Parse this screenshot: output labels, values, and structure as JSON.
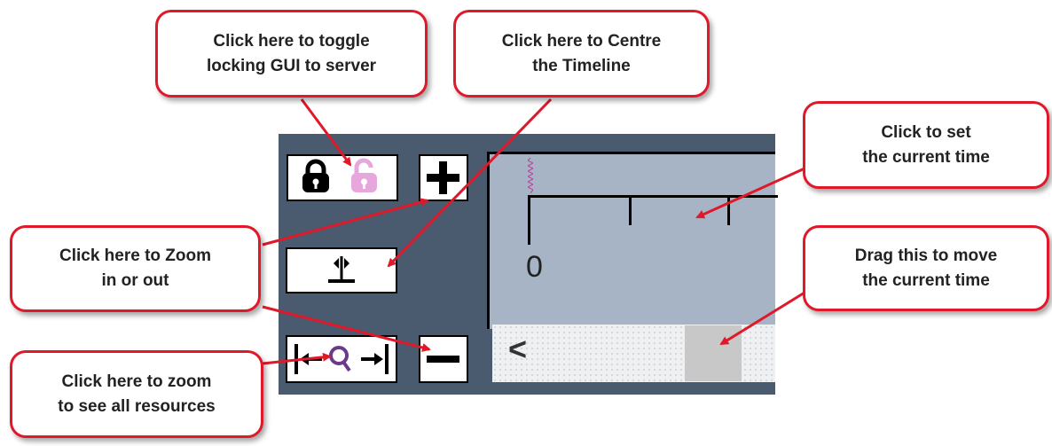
{
  "callouts": {
    "lock": "Click here to toggle\nlocking GUI to server",
    "centre": "Click here to Centre\nthe Timeline",
    "set_time": "Click to set\nthe current time",
    "zoom": "Click here to Zoom\nin or out",
    "drag": "Drag this to move\nthe current time",
    "fit": "Click here to zoom\nto see all resources"
  },
  "timeline": {
    "zero_label": "0",
    "scroll_left_glyph": "<"
  },
  "icons": {
    "lock_locked": "lock-icon",
    "lock_unlocked": "unlock-icon",
    "plus": "plus-icon",
    "minus": "minus-icon",
    "centre": "centre-timeline-icon",
    "fit": "zoom-fit-icon"
  },
  "colors": {
    "callout_border": "#e0192a",
    "panel_bg": "#4a5b6f",
    "timeline_bg": "#a7b4c5",
    "unlock_icon": "#e6a8dc",
    "fit_icon": "#6a3a8c"
  }
}
